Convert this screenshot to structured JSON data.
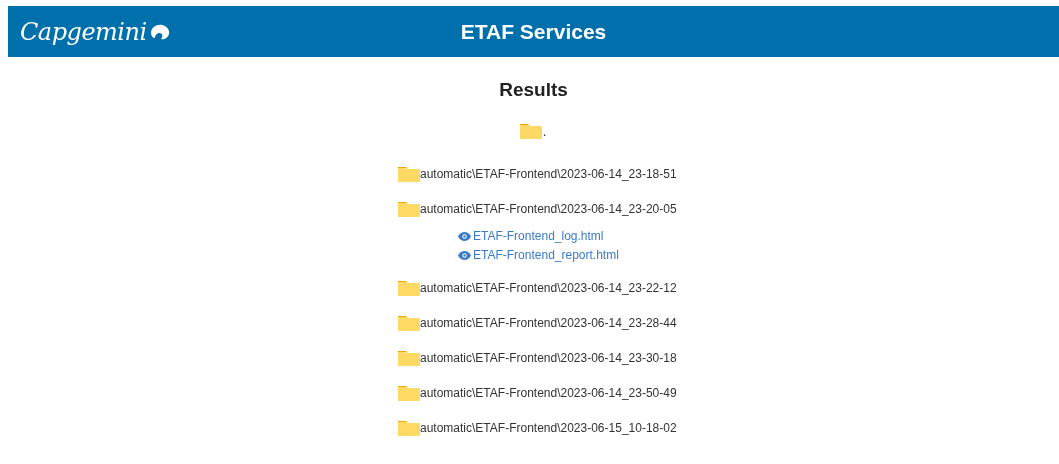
{
  "header": {
    "logo": "Capgemini",
    "title": "ETAF Services"
  },
  "page_title": "Results",
  "root": {
    "label": "."
  },
  "folders": [
    {
      "label": "automatic\\ETAF-Frontend\\2023-06-14_23-18-51"
    },
    {
      "label": "automatic\\ETAF-Frontend\\2023-06-14_23-20-05",
      "files": [
        "ETAF-Frontend_log.html",
        "ETAF-Frontend_report.html"
      ]
    },
    {
      "label": "automatic\\ETAF-Frontend\\2023-06-14_23-22-12"
    },
    {
      "label": "automatic\\ETAF-Frontend\\2023-06-14_23-28-44"
    },
    {
      "label": "automatic\\ETAF-Frontend\\2023-06-14_23-30-18"
    },
    {
      "label": "automatic\\ETAF-Frontend\\2023-06-14_23-50-49"
    },
    {
      "label": "automatic\\ETAF-Frontend\\2023-06-15_10-18-02"
    }
  ]
}
